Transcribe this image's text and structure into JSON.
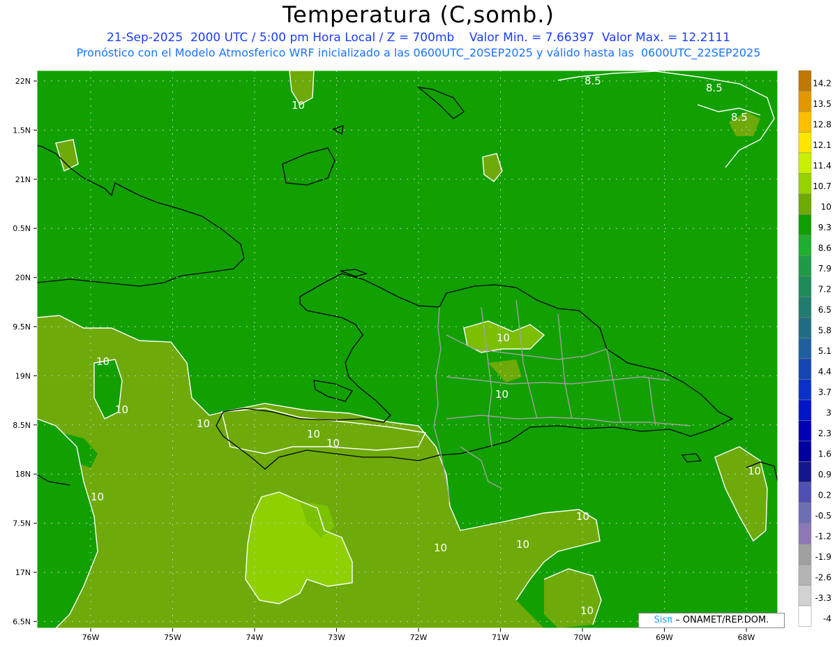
{
  "header": {
    "title": "Temperatura (C,somb.)",
    "line1": "21-Sep-2025  2000 UTC / 5:00 pm Hora Local / Z = 700mb    Valor Min. = 7.66397  Valor Max. = 12.2111",
    "line2": "Pronóstico con el Modelo Atmosferico WRF inicializado a las 0600UTC_20SEP2025 y válido hasta las  0600UTC_22SEP2025"
  },
  "axes": {
    "lat_labels": [
      "22N",
      "1.5N",
      "21N",
      "0.5N",
      "20N",
      "9.5N",
      "19N",
      "8.5N",
      "18N",
      "7.5N",
      "17N",
      "6.5N"
    ],
    "lon_labels": [
      "76W",
      "75W",
      "74W",
      "73W",
      "72W",
      "71W",
      "70W",
      "69W",
      "68W"
    ]
  },
  "colorbar": {
    "levels": [
      "14.2",
      "13.5",
      "12.8",
      "12.1",
      "11.4",
      "10.7",
      "10",
      "9.3",
      "8.6",
      "7.9",
      "7.2",
      "6.5",
      "5.8",
      "5.1",
      "4.4",
      "3.7",
      "3",
      "2.3",
      "1.6",
      "0.9",
      "0.2",
      "-0.5",
      "-1.2",
      "-1.9",
      "-2.6",
      "-3.3",
      "-4"
    ],
    "colors": [
      "#c07800",
      "#e49600",
      "#ffbe00",
      "#ffe600",
      "#c8f000",
      "#96d200",
      "#6eaa00",
      "#0fa000",
      "#1eaf2d",
      "#1e9b46",
      "#1e8c5a",
      "#1e7d6e",
      "#1e6e82",
      "#1e5fa0",
      "#1446b4",
      "#0a32c8",
      "#0014c8",
      "#0000b4",
      "#0000a0",
      "#14148c",
      "#5050b4",
      "#6e6eb4",
      "#8c78b4",
      "#a0a0a0",
      "#b4b4b4",
      "#d2d2d2",
      "#ffffff"
    ]
  },
  "contour_labels": {
    "c10": "10",
    "c85": "8.5"
  },
  "credit": {
    "sis": "Sisπ",
    "rest": "– ONAMET/REP.DOM."
  },
  "colors": {
    "base_green": "#11a000",
    "olive": "#6eaa0a",
    "bright": "#8fd000",
    "dark_green": "#0d9610"
  }
}
